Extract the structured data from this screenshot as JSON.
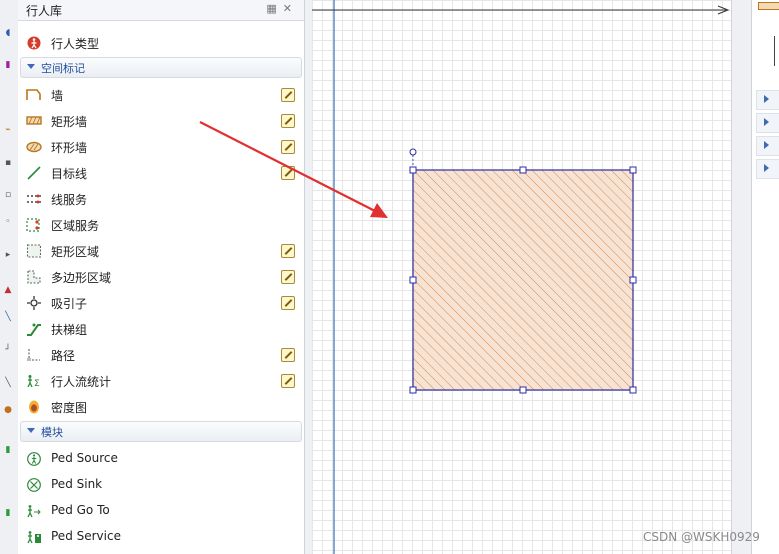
{
  "palette": {
    "title": "行人库",
    "top_item": {
      "label": "行人类型",
      "icon": "pedestrian-type-icon"
    },
    "space_section": {
      "title": "空间标记",
      "items": [
        {
          "label": "墙",
          "icon": "wall-icon",
          "editable": true
        },
        {
          "label": "矩形墙",
          "icon": "rectangular-wall-icon",
          "editable": true
        },
        {
          "label": "环形墙",
          "icon": "circular-wall-icon",
          "editable": true
        },
        {
          "label": "目标线",
          "icon": "target-line-icon",
          "editable": true
        },
        {
          "label": "线服务",
          "icon": "line-service-icon",
          "editable": false
        },
        {
          "label": "区域服务",
          "icon": "area-service-icon",
          "editable": false
        },
        {
          "label": "矩形区域",
          "icon": "rectangular-area-icon",
          "editable": true
        },
        {
          "label": "多边形区域",
          "icon": "polygonal-area-icon",
          "editable": true
        },
        {
          "label": "吸引子",
          "icon": "attractor-icon",
          "editable": true
        },
        {
          "label": "扶梯组",
          "icon": "escalator-group-icon",
          "editable": false
        },
        {
          "label": "路径",
          "icon": "path-icon",
          "editable": true
        },
        {
          "label": "行人流统计",
          "icon": "ped-flow-statistics-icon",
          "editable": true
        },
        {
          "label": "密度图",
          "icon": "density-map-icon",
          "editable": false
        }
      ]
    },
    "blocks_section": {
      "title": "模块",
      "items": [
        {
          "label": "Ped Source",
          "icon": "ped-source-icon"
        },
        {
          "label": "Ped Sink",
          "icon": "ped-sink-icon"
        },
        {
          "label": "Ped Go To",
          "icon": "ped-go-to-icon"
        },
        {
          "label": "Ped Service",
          "icon": "ped-service-icon"
        }
      ]
    }
  },
  "colors": {
    "accent": "#3d6bb3",
    "arrow": "#e03030",
    "wall_hatch": "#d98a4a",
    "wall_fill": "#f7e3d3",
    "selection": "#2c2ca8"
  },
  "watermark": "CSDN @WSKH0929"
}
